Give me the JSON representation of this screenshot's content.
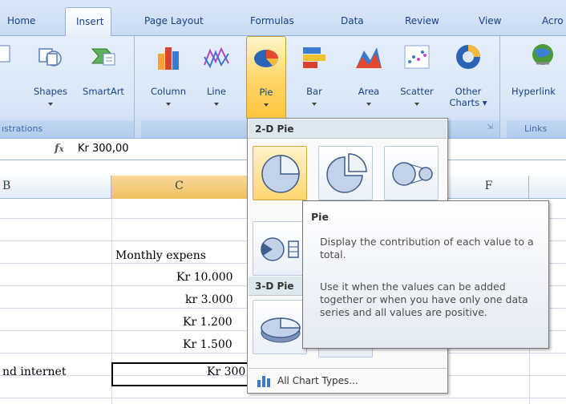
{
  "tabs": [
    "Home",
    "Insert",
    "Page Layout",
    "Formulas",
    "Data",
    "Review",
    "View",
    "Acro"
  ],
  "active_tab": "Insert",
  "ribbon": {
    "illustrations": {
      "title": "ıstrations",
      "shapes": "Shapes",
      "smartart": "SmartArt"
    },
    "charts": {
      "column": "Column",
      "line": "Line",
      "pie": "Pie",
      "bar": "Bar",
      "area": "Area",
      "scatter": "Scatter",
      "other_1": "Other",
      "other_2": "Charts"
    },
    "links": {
      "title": "Links",
      "hyperlink": "Hyperlink"
    }
  },
  "formula_bar": {
    "fx": "fx",
    "value": "Kr 300,00"
  },
  "columns": [
    "B",
    "C",
    "F"
  ],
  "cells": {
    "c_header": "Monthly expens",
    "v1": "Kr 10.000",
    "v2": "kr 3.000",
    "v3": "Kr 1.200",
    "v4": "Kr 1.500",
    "b_row": "nd internet",
    "v5": "Kr 300"
  },
  "pie_menu": {
    "section_2d": "2-D Pie",
    "section_3d": "3-D Pie",
    "all_chart_types": "All Chart Types..."
  },
  "tooltip": {
    "title": "Pie",
    "p1": "Display the contribution of each value to a total.",
    "p2": "Use it when the values can be added together or when you have only one data series and all values are positive."
  },
  "colors": {
    "accent": "#15428b",
    "selected": "#ffd66e",
    "ribbon": "#d8e6f7"
  }
}
